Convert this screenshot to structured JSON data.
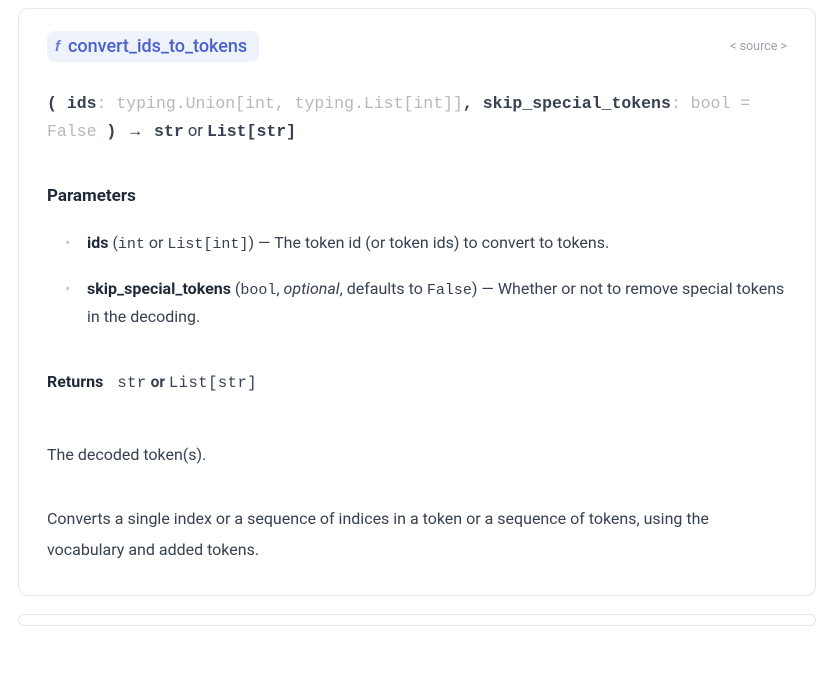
{
  "header": {
    "icon_char": "f",
    "function_name": "convert_ids_to_tokens",
    "source_label": "< source >"
  },
  "signature": {
    "open": "(",
    "p1_name": "ids",
    "p1_sep": ": ",
    "p1_type": "typing.Union[int, typing.List[int]]",
    "comma": ", ",
    "p2_name": "skip_special_tokens",
    "p2_sep": ": ",
    "p2_type": "bool = False",
    "close": " )",
    "arrow": " → ",
    "ret1": "str",
    "ret_or": " or ",
    "ret2": "List[str]"
  },
  "sections": {
    "parameters_heading": "Parameters",
    "returns_label": "Returns"
  },
  "params": [
    {
      "name": "ids",
      "type_open": " (",
      "type1": "int",
      "type_or": " or ",
      "type2": "List[int]",
      "type_close": ") — ",
      "desc": "The token id (or token ids) to convert to tokens."
    },
    {
      "name": "skip_special_tokens",
      "type_open": " (",
      "type1": "bool",
      "comma1": ", ",
      "optional": "optional",
      "comma2": ", defaults to ",
      "default": "False",
      "type_close": ") — ",
      "desc": "Whether or not to remove special tokens in the decoding."
    }
  ],
  "returns": {
    "type1": "str",
    "or": " or ",
    "type2": "List[str]"
  },
  "desc_short": "The decoded token(s).",
  "desc_long": "Converts a single index or a sequence of indices in a token or a sequence of tokens, using the vocabulary and added tokens."
}
